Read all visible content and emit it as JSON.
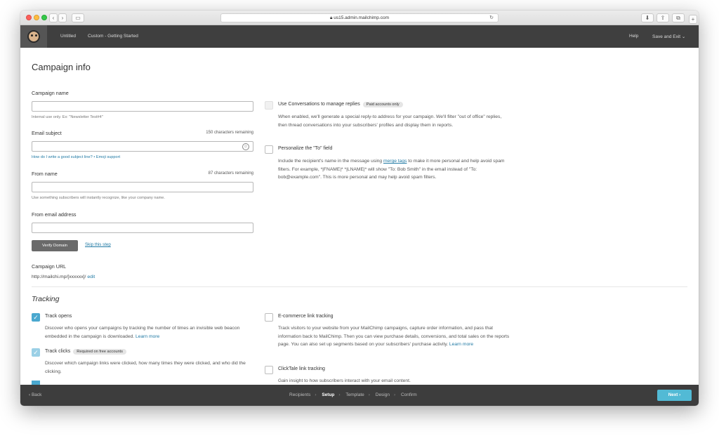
{
  "browser": {
    "url": "us15.admin.mailchimp.com",
    "nav_back": "‹",
    "nav_forward": "›",
    "reload": "↻"
  },
  "app": {
    "breadcrumb_untitled": "Untitled",
    "breadcrumb_template": "Custom - Getting Started",
    "help": "Help",
    "save_exit": "Save and Exit ⌄"
  },
  "page": {
    "title": "Campaign info"
  },
  "form": {
    "campaign_name_label": "Campaign name",
    "campaign_name_help": "Internal use only. Ex: \"Newsletter Test#4\"",
    "email_subject_label": "Email subject",
    "email_subject_counter": "150 characters remaining",
    "subject_help_link": "How do I write a good subject line?",
    "subject_help_sep": " • ",
    "emoji_link": "Emoji support",
    "from_name_label": "From name",
    "from_name_counter": "87 characters remaining",
    "from_name_help": "Use something subscribers will instantly recognize, like your company name.",
    "from_email_label": "From email address",
    "verify_button": "Verify Domain",
    "skip_link": "Skip this step",
    "campaign_url_label": "Campaign URL",
    "campaign_url_value": "http://mailchi.mp/[xxxxxx]/",
    "campaign_url_edit": "edit"
  },
  "options": {
    "conversations_label": "Use Conversations to manage replies",
    "conversations_badge": "Paid accounts only",
    "conversations_desc": "When enabled, we'll generate a special reply-to address for your campaign. We'll filter \"out of office\" replies, then thread conversations into your subscribers' profiles and display them in reports.",
    "personalize_label": "Personalize the \"To\" field",
    "personalize_desc_1": "Include the recipient's name in the message using ",
    "personalize_link": "merge tags",
    "personalize_desc_2": " to make it more personal and help avoid spam filters. For example, *|FNAME|* *|LNAME|* will show \"To: Bob Smith\" in the email instead of \"To: bob@example.com\". This is more personal and may help avoid spam filters."
  },
  "tracking": {
    "title": "Tracking",
    "opens_label": "Track opens",
    "opens_desc": "Discover who opens your campaigns by tracking the number of times an invisible web beacon embedded in the campaign is downloaded.",
    "opens_link": "Learn more",
    "clicks_label": "Track clicks",
    "clicks_badge": "Required on free accounts",
    "clicks_desc": "Discover which campaign links were clicked, how many times they were clicked, and who did the clicking.",
    "ecommerce_label": "E-commerce link tracking",
    "ecommerce_desc": "Track visitors to your website from your MailChimp campaigns, capture order information, and pass that information back to MailChimp. Then you can view purchase details, conversions, and total sales on the reports page. You can also set up segments based on your subscribers' purchase activity.",
    "ecommerce_link": "Learn more",
    "clicktale_label": "ClickTale link tracking",
    "clicktale_desc": "Gain insight to how subscribers interact with your email content."
  },
  "footer": {
    "back": "‹  Back",
    "steps": [
      "Recipients",
      "Setup",
      "Template",
      "Design",
      "Confirm"
    ],
    "sep": "›",
    "next": "Next  ›"
  }
}
